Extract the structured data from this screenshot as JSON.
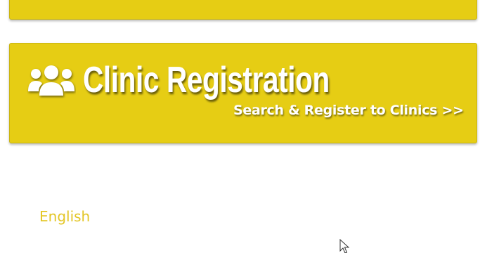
{
  "colors": {
    "card_background": "#e6cd14",
    "card_border": "#c9b512",
    "text_on_card": "#ffffff",
    "language_link": "#e3c626",
    "page_background": "#ffffff"
  },
  "clinic_card": {
    "icon": "users-icon",
    "title": "Clinic Registration",
    "subtitle": "Search & Register to Clinics >>"
  },
  "language": {
    "label": "English"
  }
}
